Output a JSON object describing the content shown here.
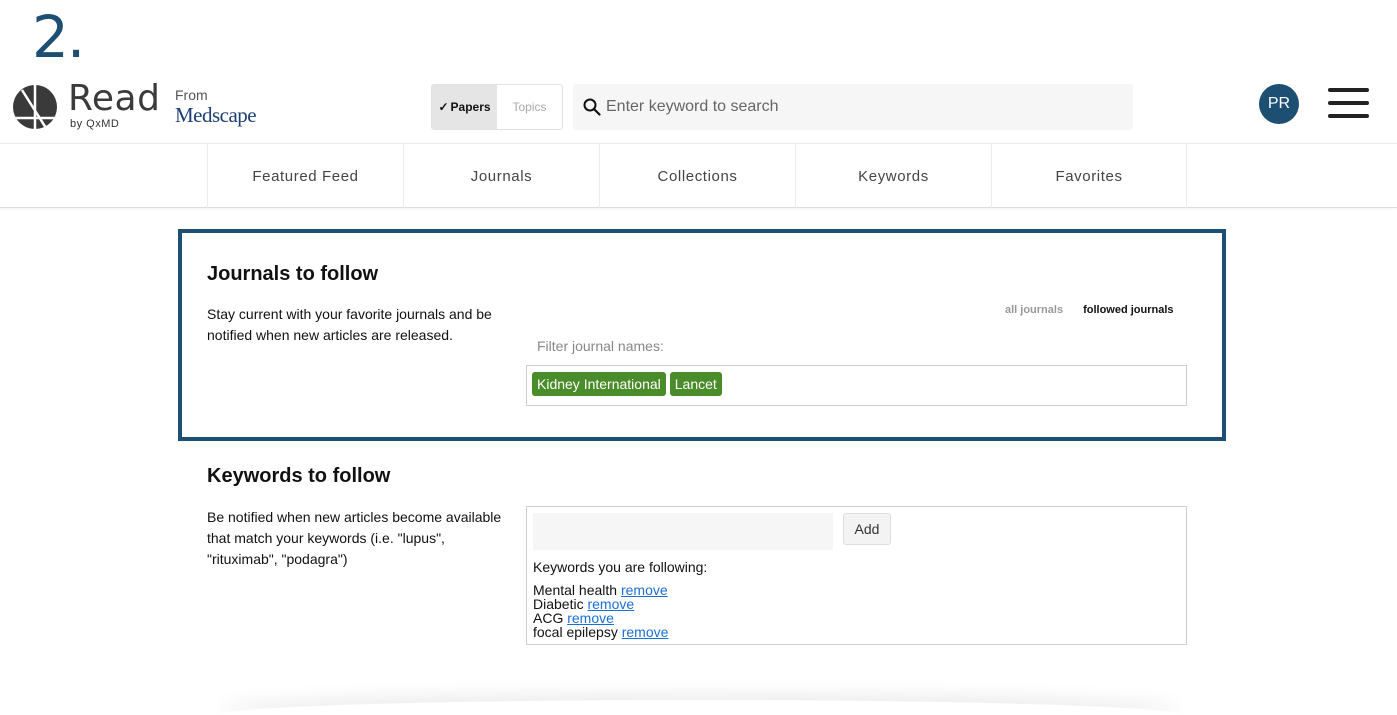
{
  "step_number": "2.",
  "brand": {
    "app_name": "Read",
    "by_line": "by QxMD",
    "from_label": "From",
    "partner_name": "Medscape"
  },
  "search_mode": {
    "options": [
      {
        "label": "Papers",
        "selected": true
      },
      {
        "label": "Topics",
        "selected": false
      }
    ]
  },
  "search": {
    "placeholder": "Enter keyword to search",
    "value": ""
  },
  "user": {
    "initials": "PR"
  },
  "icons": {
    "search": "search-icon",
    "menu": "hamburger-menu-icon",
    "check": "check-icon"
  },
  "nav": {
    "tabs": [
      "Featured Feed",
      "Journals",
      "Collections",
      "Keywords",
      "Favorites"
    ]
  },
  "journals": {
    "title": "Journals to follow",
    "description": "Stay current with your favorite journals and be notified when new articles are released.",
    "filter_options": [
      "all journals",
      "followed journals"
    ],
    "active_filter": "followed journals",
    "filter_label": "Filter journal names:",
    "followed": [
      "Kidney International",
      "Lancet"
    ]
  },
  "keywords": {
    "title": "Keywords to follow",
    "description": "Be notified when new articles become available that match your keywords (i.e. \"lupus\", \"rituximab\", \"podagra\")",
    "input_value": "",
    "add_label": "Add",
    "following_label": "Keywords you are following:",
    "remove_label": "remove",
    "items": [
      "Mental health",
      "Diabetic",
      "ACG",
      "focal epilepsy"
    ]
  },
  "colors": {
    "brand_blue": "#1d4f73",
    "tag_green": "#4a8b2a",
    "link_blue": "#1a6fd6"
  }
}
